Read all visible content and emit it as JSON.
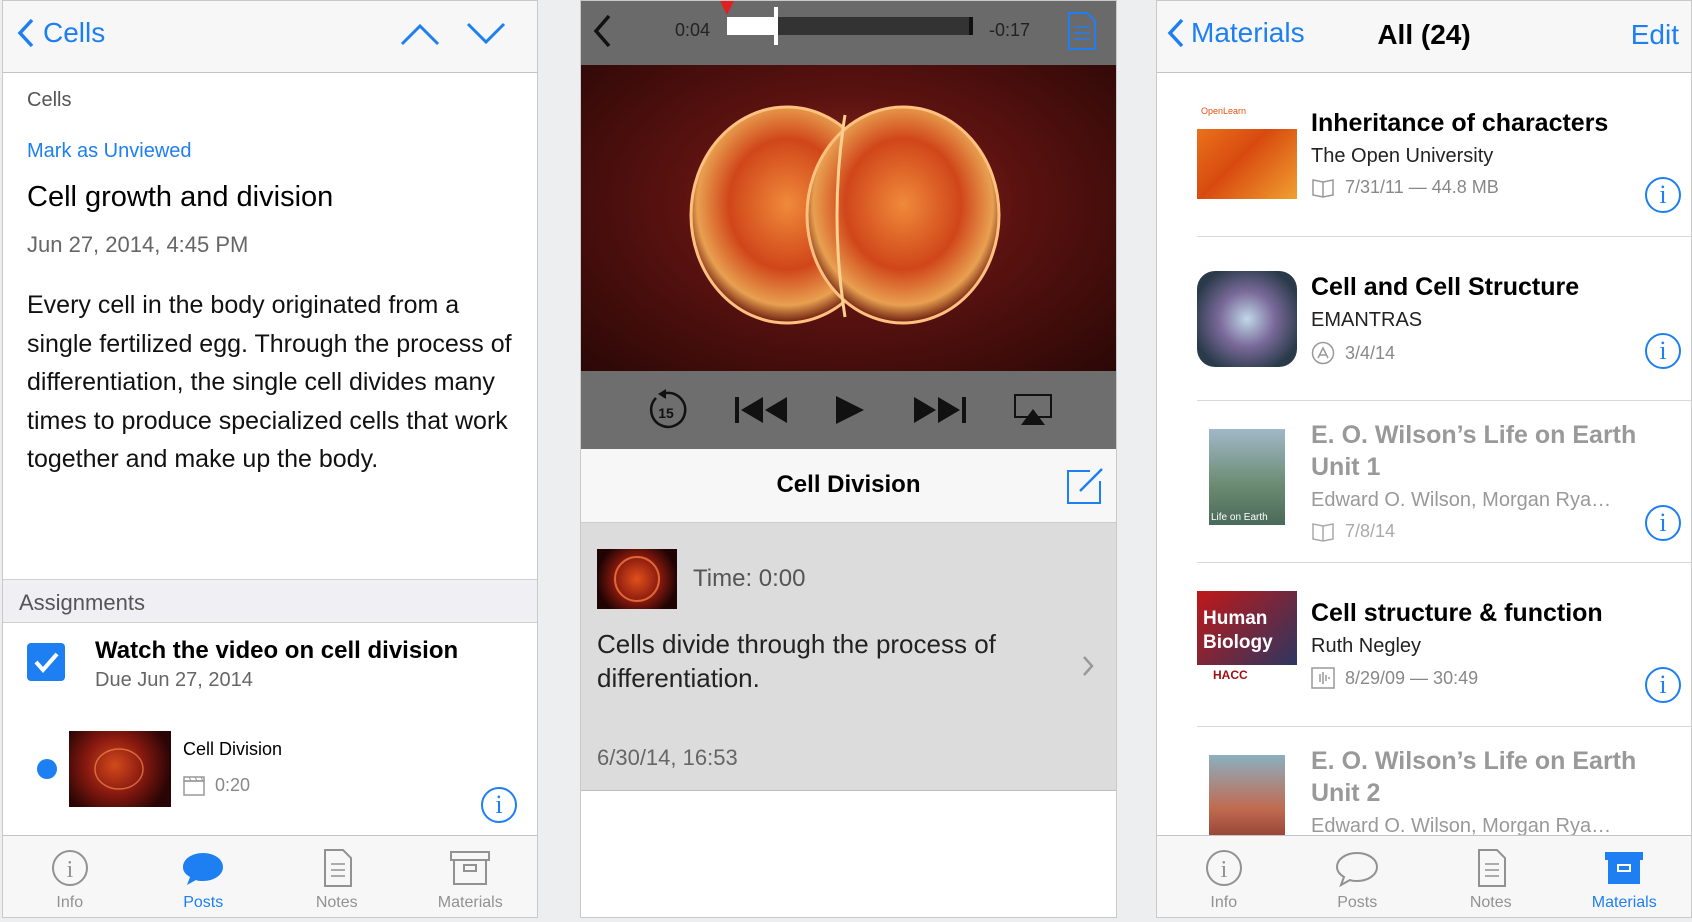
{
  "colors": {
    "accent": "#1e7ff2",
    "tab_inactive": "#929292"
  },
  "panel1": {
    "back_label": "Cells",
    "breadcrumb": "Cells",
    "mark_unviewed": "Mark as Unviewed",
    "title": "Cell growth and division",
    "date": "Jun 27, 2014, 4:45 PM",
    "body": "Every cell in the body originated from a single fertilized egg. Through the process of differentiation, the single cell divides many times to produce specialized cells that work together and make up the body.",
    "section_header": "Assignments",
    "assignment": {
      "title": "Watch the video on cell division",
      "due": "Due Jun 27, 2014",
      "checked": true
    },
    "video": {
      "name": "Cell Division",
      "duration": "0:20"
    },
    "tabs": [
      {
        "label": "Info",
        "icon": "info-icon"
      },
      {
        "label": "Posts",
        "icon": "speech-bubble-icon"
      },
      {
        "label": "Notes",
        "icon": "notes-icon"
      },
      {
        "label": "Materials",
        "icon": "archive-box-icon"
      }
    ],
    "active_tab": "Posts"
  },
  "panel2": {
    "elapsed": "0:04",
    "remaining": "-0:17",
    "progress": 0.2,
    "skip_seconds": "15",
    "note_header": "Cell Division",
    "note_time": "Time: 0:00",
    "note_text": "Cells divide through the process of differentiation.",
    "note_date": "6/30/14, 16:53"
  },
  "panel3": {
    "back_label": "Materials",
    "title": "All (24)",
    "edit": "Edit",
    "items": [
      {
        "title": "Inheritance of characters",
        "author": "The Open University",
        "meta": "7/31/11 — 44.8 MB",
        "icon": "book-icon",
        "dim": false,
        "cover_label": "OpenLearn"
      },
      {
        "title": "Cell and Cell Structure",
        "author": "EMANTRAS",
        "meta": "3/4/14",
        "icon": "app-store-icon",
        "dim": false
      },
      {
        "title": "E. O. Wilson’s Life on Earth Unit 1",
        "author": "Edward O. Wilson, Morgan Rya…",
        "meta": "7/8/14",
        "icon": "book-icon",
        "dim": true,
        "cover_label": "Life on Earth"
      },
      {
        "title": "Cell structure & function",
        "author": "Ruth Negley",
        "meta": "8/29/09 — 30:49",
        "icon": "audio-icon",
        "dim": false,
        "cover_label": "Human Biology",
        "cover_sub": "HACC"
      },
      {
        "title": "E. O. Wilson’s Life on Earth Unit 2",
        "author": "Edward O. Wilson, Morgan Rya…",
        "meta": "",
        "icon": "book-icon",
        "dim": true
      }
    ],
    "tabs": [
      {
        "label": "Info",
        "icon": "info-icon"
      },
      {
        "label": "Posts",
        "icon": "speech-bubble-icon"
      },
      {
        "label": "Notes",
        "icon": "notes-icon"
      },
      {
        "label": "Materials",
        "icon": "archive-box-icon"
      }
    ],
    "active_tab": "Materials"
  }
}
